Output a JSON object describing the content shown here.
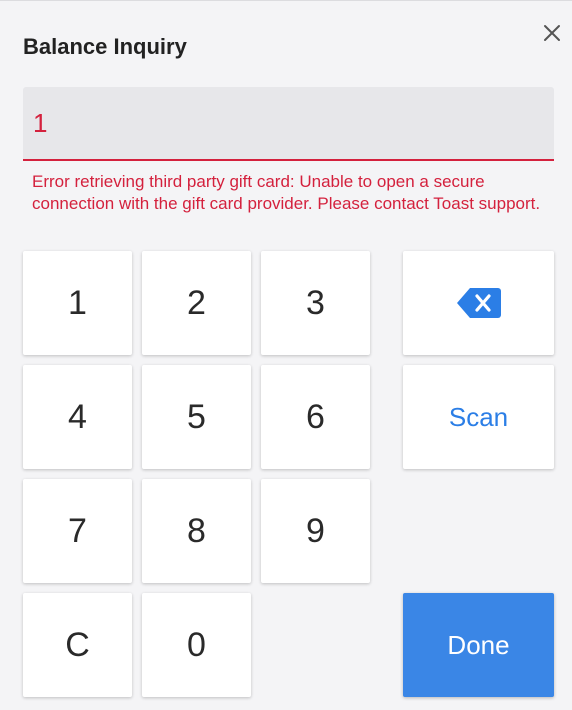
{
  "dialog": {
    "title": "Balance Inquiry",
    "close_icon": "close-icon"
  },
  "input": {
    "value": "1"
  },
  "error": {
    "message": "Error retrieving third party gift card: Unable to open a secure connection with the gift card provider. Please contact Toast support."
  },
  "keypad": {
    "k1": "1",
    "k2": "2",
    "k3": "3",
    "k4": "4",
    "k5": "5",
    "k6": "6",
    "k7": "7",
    "k8": "8",
    "k9": "9",
    "clear": "C",
    "k0": "0",
    "backspace_icon": "backspace-icon",
    "scan": "Scan",
    "done": "Done"
  },
  "colors": {
    "error": "#d4213d",
    "accent": "#3a86e6"
  }
}
